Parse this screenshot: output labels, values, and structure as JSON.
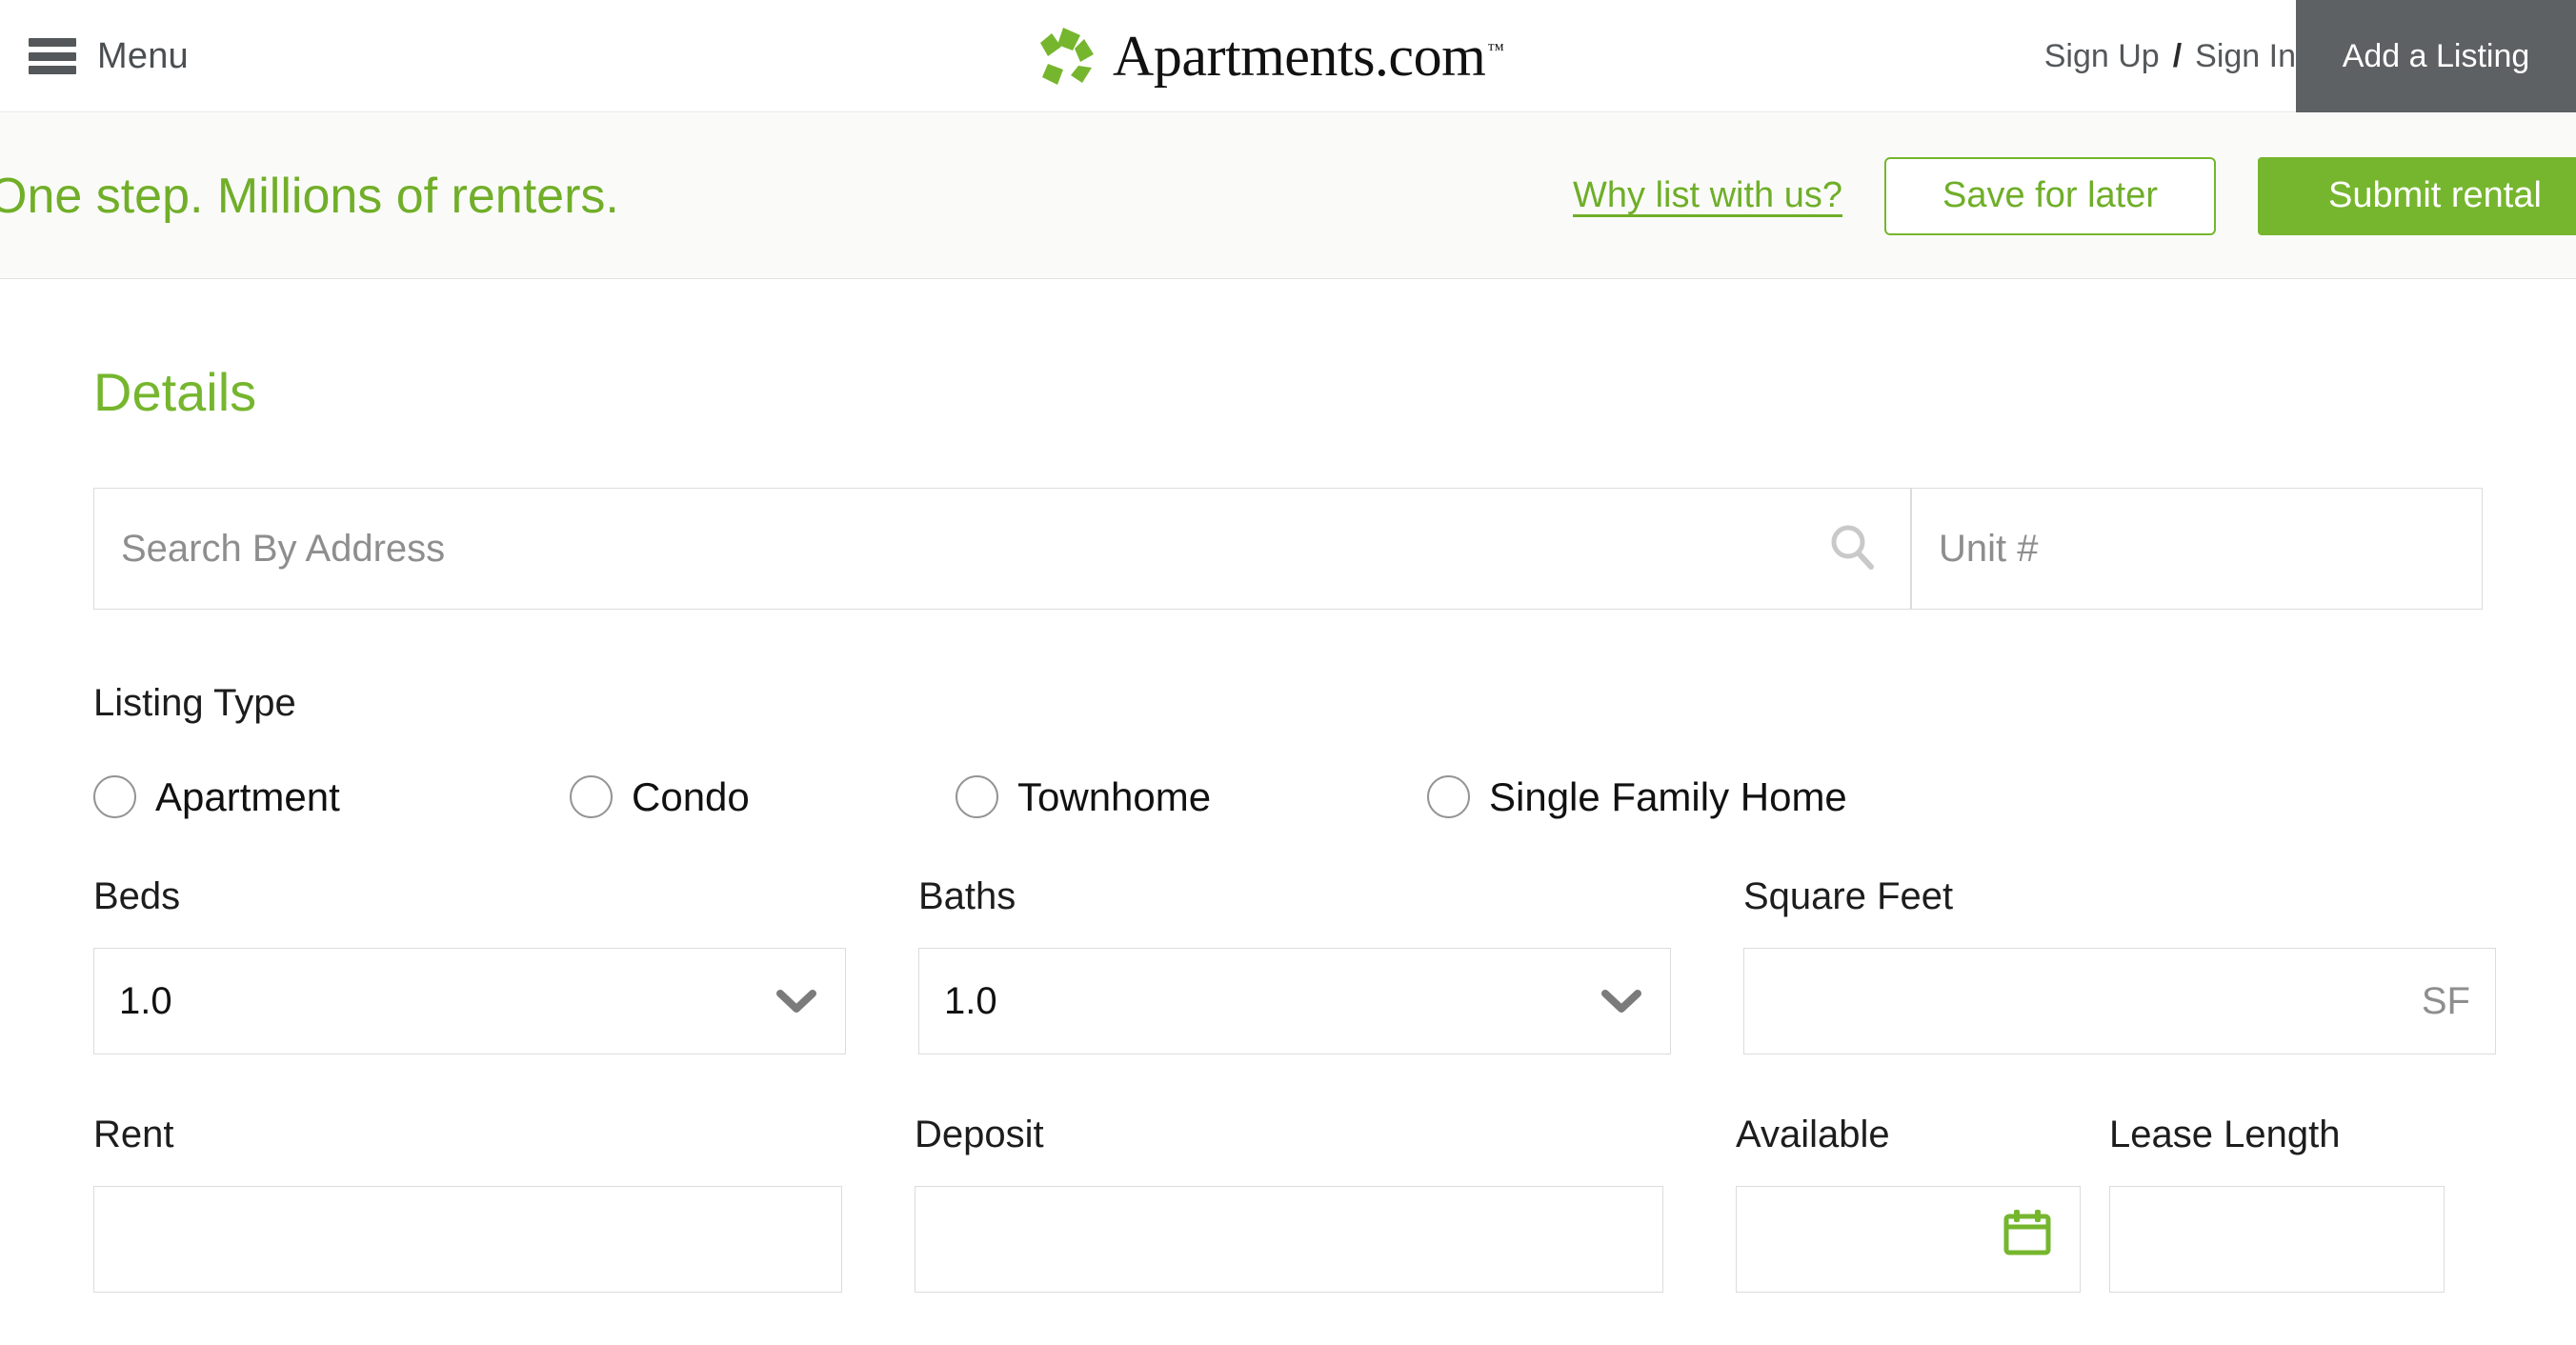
{
  "header": {
    "menu_label": "Menu",
    "logo_text": "Apartments.com",
    "logo_tm": "™",
    "sign_up": "Sign Up",
    "separator": "/",
    "sign_in": "Sign In",
    "add_listing": "Add a Listing",
    "menu_icon": "hamburger-icon",
    "logo_icon": "apartments-pinwheel-logo",
    "add_listing_bg": "#5e6163"
  },
  "banner": {
    "tagline": "One step. Millions of renters.",
    "why_link": "Why list with us?",
    "save_button": "Save for later",
    "submit_button": "Submit rental",
    "accent_green": "#76b62e",
    "background": "#fafbf9"
  },
  "form": {
    "section_title": "Details",
    "search": {
      "placeholder": "Search By Address",
      "value": "",
      "icon": "search-icon"
    },
    "unit": {
      "placeholder": "Unit #",
      "value": ""
    },
    "listing_type": {
      "label": "Listing Type",
      "options": [
        {
          "label": "Apartment",
          "selected": false
        },
        {
          "label": "Condo",
          "selected": false
        },
        {
          "label": "Townhome",
          "selected": false
        },
        {
          "label": "Single Family Home",
          "selected": false
        }
      ]
    },
    "beds": {
      "label": "Beds",
      "value": "1.0",
      "icon": "chevron-down-icon"
    },
    "baths": {
      "label": "Baths",
      "value": "1.0",
      "icon": "chevron-down-icon"
    },
    "square_feet": {
      "label": "Square Feet",
      "value": "",
      "suffix": "SF"
    },
    "rent": {
      "label": "Rent",
      "value": ""
    },
    "deposit": {
      "label": "Deposit",
      "value": ""
    },
    "available": {
      "label": "Available",
      "value": "",
      "icon": "calendar-icon"
    },
    "lease_length": {
      "label": "Lease Length",
      "value": ""
    }
  }
}
